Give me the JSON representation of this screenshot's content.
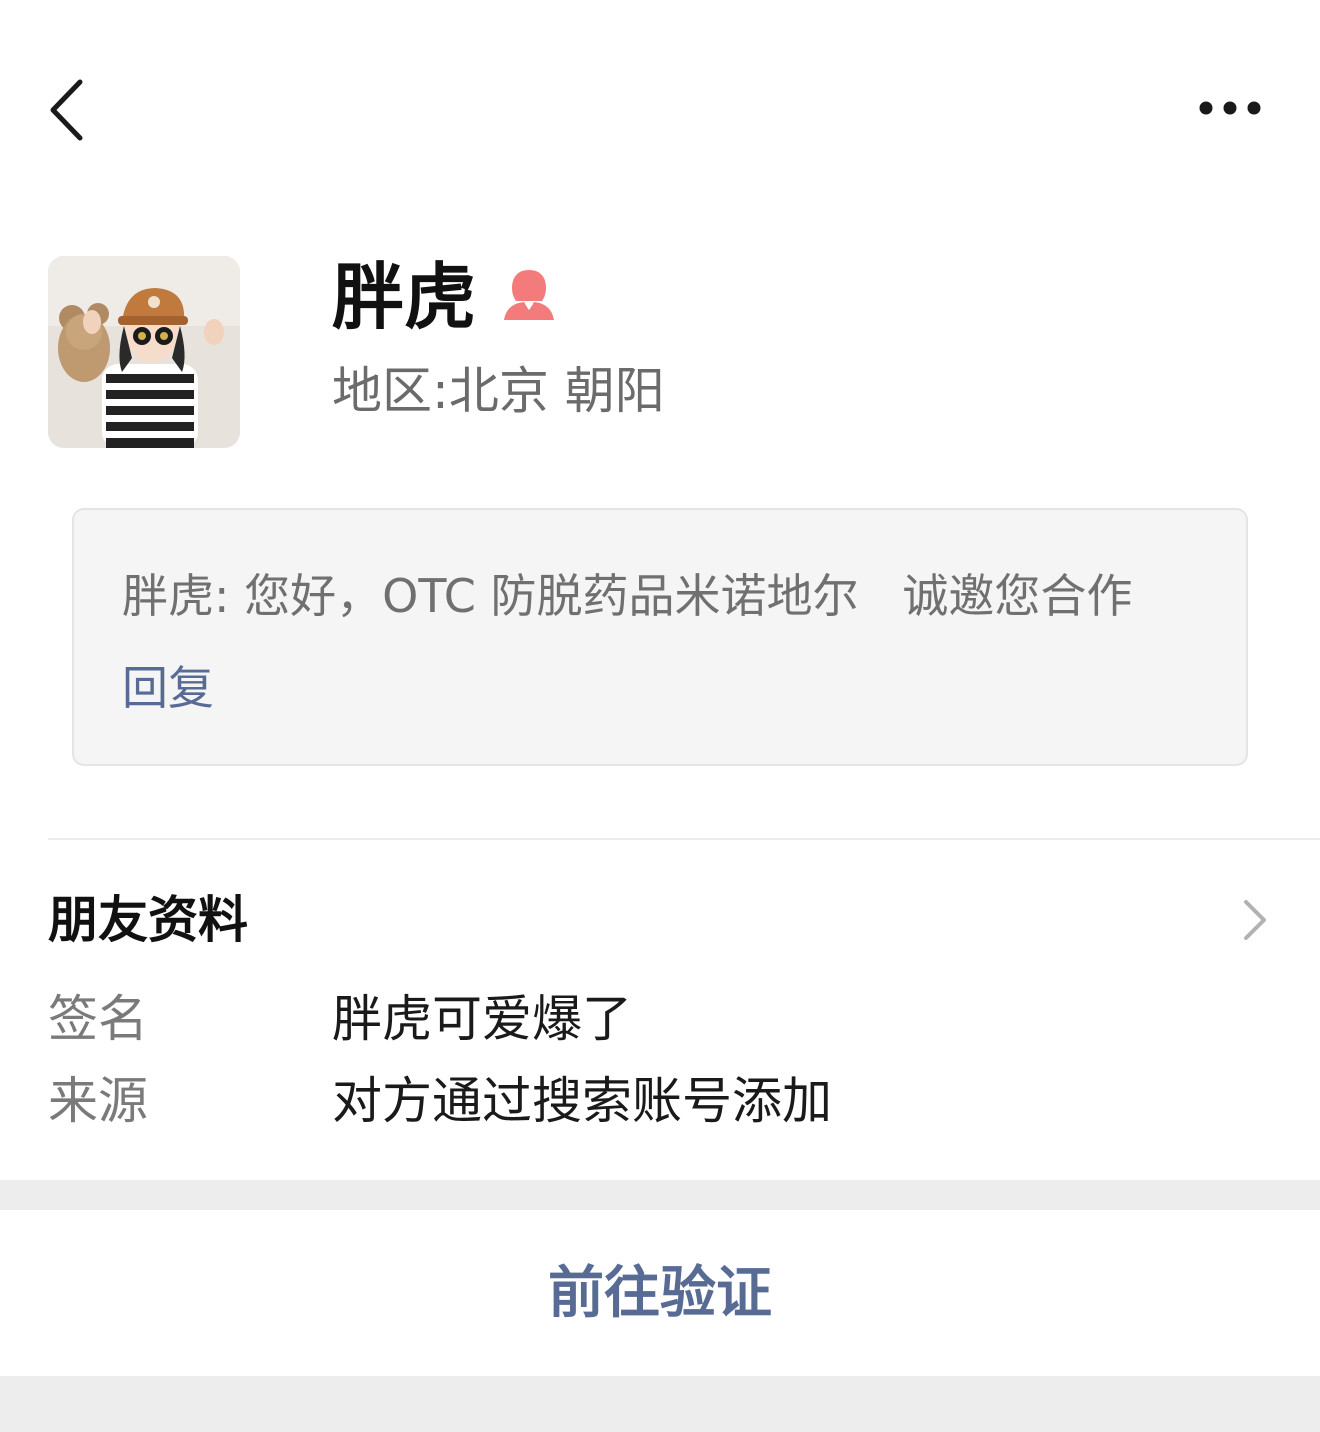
{
  "colors": {
    "link": "#576b95",
    "gender_female": "#f37b7b",
    "background_gray": "#ededed"
  },
  "header": {
    "back_icon": "chevron-left-icon",
    "more_icon": "more-dots-icon"
  },
  "profile": {
    "name": "胖虎",
    "gender_icon": "female-icon",
    "region_label": "地区:",
    "region_value": "北京 朝阳"
  },
  "greeting": {
    "message": "胖虎: 您好，OTC 防脱药品米诺地尔   诚邀您合作",
    "reply_label": "回复"
  },
  "friend_info": {
    "title": "朋友资料",
    "chevron_icon": "chevron-right-icon",
    "rows": [
      {
        "label": "签名",
        "value": "胖虎可爱爆了"
      },
      {
        "label": "来源",
        "value": "对方通过搜索账号添加"
      }
    ]
  },
  "actions": {
    "verify_label": "前往验证"
  }
}
